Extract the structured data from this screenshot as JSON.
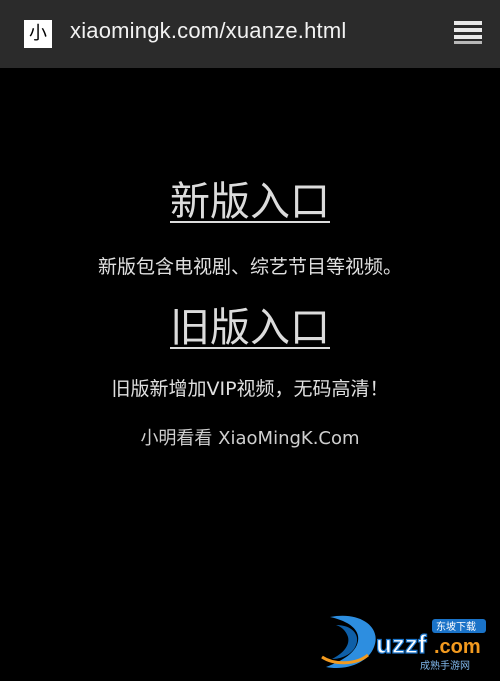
{
  "browser": {
    "site_icon_char": "小",
    "url": "xiaomingk.com/xuanze.html",
    "menu_icon": "hamburger-menu-icon"
  },
  "main": {
    "new_entry_label": "新版入口",
    "new_entry_desc": "新版包含电视剧、综艺节目等视频。",
    "old_entry_label": "旧版入口",
    "old_entry_desc": "旧版新增加VIP视频，无码高清！",
    "footer": "小明看看 XiaoMingK.Com"
  },
  "watermark": {
    "brand": "uzzf.com",
    "tagline_top": "东坡下载",
    "tagline_bottom": "成熟手游网"
  },
  "colors": {
    "background": "#000000",
    "topbar": "#2b2b2b",
    "text": "#e0e0e0",
    "watermark_blue": "#1a73c8",
    "watermark_orange": "#f29a1f"
  }
}
